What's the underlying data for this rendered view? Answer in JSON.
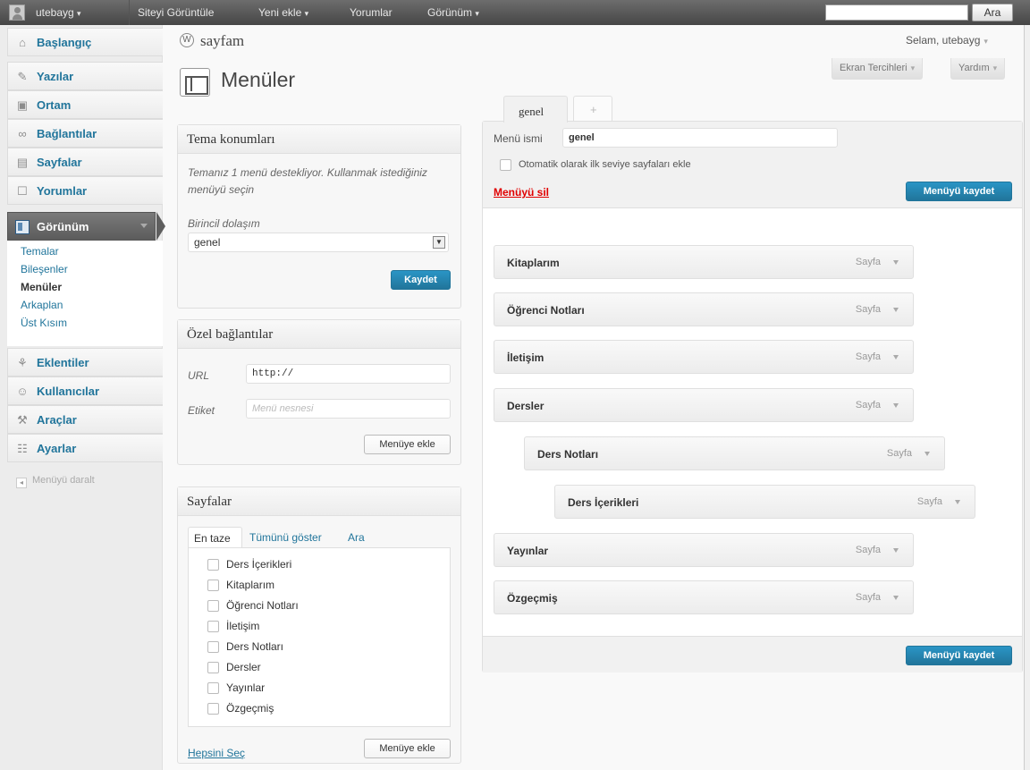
{
  "adminbar": {
    "user": "utebayg",
    "view_site": "Siteyi Görüntüle",
    "new": "Yeni ekle",
    "comments": "Yorumlar",
    "appearance": "Görünüm",
    "search_button": "Ara",
    "caret": "▾"
  },
  "sidebar": {
    "items": [
      {
        "label": "Başlangıç",
        "icon": "home-icon"
      },
      {
        "label": "Yazılar",
        "icon": "pin-icon"
      },
      {
        "label": "Ortam",
        "icon": "media-icon"
      },
      {
        "label": "Bağlantılar",
        "icon": "link-icon"
      },
      {
        "label": "Sayfalar",
        "icon": "pages-icon"
      },
      {
        "label": "Yorumlar",
        "icon": "comment-icon"
      }
    ],
    "current": "Görünüm",
    "submenu": [
      "Temalar",
      "Bileşenler",
      "Menüler",
      "Arkaplan",
      "Üst Kısım"
    ],
    "items_bottom": [
      {
        "label": "Eklentiler",
        "icon": "plugin-icon"
      },
      {
        "label": "Kullanıcılar",
        "icon": "users-icon"
      },
      {
        "label": "Araçlar",
        "icon": "tools-icon"
      },
      {
        "label": "Ayarlar",
        "icon": "settings-icon"
      }
    ],
    "collapse": "Menüyü daralt"
  },
  "header": {
    "site_name": "sayfam",
    "howdy": "Selam, utebayg",
    "screen_options": "Ekran Tercihleri",
    "help": "Yardım",
    "page_title": "Menüler"
  },
  "theme_locations": {
    "title": "Tema konumları",
    "desc": "Temanız 1 menü destekliyor. Kullanmak istediğiniz menüyü seçin",
    "label": "Birincil dolaşım",
    "selected": "genel",
    "save": "Kaydet"
  },
  "custom_links": {
    "title": "Özel bağlantılar",
    "url_label": "URL",
    "url_value": "http://",
    "label_label": "Etiket",
    "label_placeholder": "Menü nesnesi",
    "add": "Menüye ekle"
  },
  "pages_box": {
    "title": "Sayfalar",
    "tabs": [
      "En taze",
      "Tümünü göster",
      "Ara"
    ],
    "pages": [
      "Ders İçerikleri",
      "Kitaplarım",
      "Öğrenci Notları",
      "İletişim",
      "Ders Notları",
      "Dersler",
      "Yayınlar",
      "Özgeçmiş"
    ],
    "select_all": "Hepsini Seç",
    "add": "Menüye ekle"
  },
  "editor": {
    "tab_active": "genel",
    "tab_add": "+",
    "name_label": "Menü ismi",
    "name_value": "genel",
    "auto_add": "Otomatik olarak ilk seviye sayfaları ekle",
    "delete": "Menüyü sil",
    "save": "Menüyü kaydet",
    "items": [
      {
        "title": "Kitaplarım",
        "type": "Sayfa",
        "depth": 0
      },
      {
        "title": "Öğrenci Notları",
        "type": "Sayfa",
        "depth": 0
      },
      {
        "title": "İletişim",
        "type": "Sayfa",
        "depth": 0
      },
      {
        "title": "Dersler",
        "type": "Sayfa",
        "depth": 0
      },
      {
        "title": "Ders Notları",
        "type": "Sayfa",
        "depth": 1
      },
      {
        "title": "Ders İçerikleri",
        "type": "Sayfa",
        "depth": 2
      },
      {
        "title": "Yayınlar",
        "type": "Sayfa",
        "depth": 0
      },
      {
        "title": "Özgeçmiş",
        "type": "Sayfa",
        "depth": 0
      }
    ]
  },
  "colors": {
    "link": "#21759b",
    "primary_button": "#21759b",
    "delete": "#e00000"
  }
}
